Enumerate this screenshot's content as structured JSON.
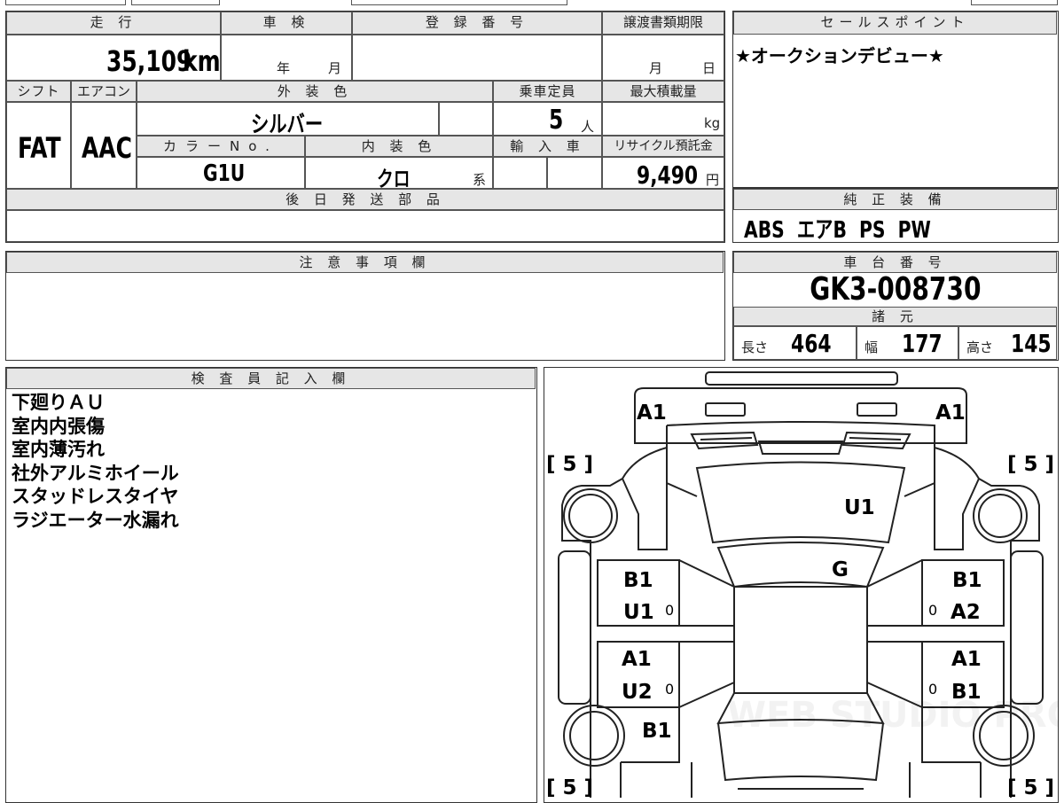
{
  "vehicle": {
    "mileage_label": "走 行",
    "mileage_value": "35,109",
    "mileage_unit": "km",
    "inspection_label": "車 検",
    "inspection_year_unit": "年",
    "inspection_month_unit": "月",
    "registration_label": "登 録 番 号",
    "transfer_deadline_label": "譲渡書類期限",
    "transfer_month_unit": "月",
    "transfer_day_unit": "日",
    "shift_label": "シフト",
    "shift_value": "FAT",
    "aircon_label": "エアコン",
    "aircon_value": "AAC",
    "exterior_color_label": "外 装 色",
    "exterior_color_value": "シルバー",
    "capacity_label": "乗車定員",
    "capacity_value": "5",
    "capacity_unit": "人",
    "max_load_label": "最大積載量",
    "max_load_unit": "kg",
    "color_no_label": "カラーNo.",
    "color_no_value": "G1U",
    "interior_color_label": "内 装 色",
    "interior_color_value": "クロ",
    "interior_color_suffix": "系",
    "import_label": "輸 入 車",
    "recycle_label": "リサイクル預託金",
    "recycle_value": "9,490",
    "recycle_unit": "円",
    "later_parts_label": "後 日 発 送 部 品"
  },
  "sales_point": {
    "label": "セールスポイント",
    "text": "★オークションデビュー★"
  },
  "equipment": {
    "label": "純 正 装 備",
    "items": "ABS  エアB  PS  PW"
  },
  "notes": {
    "label": "注 意 事 項 欄"
  },
  "chassis": {
    "label": "車 台 番 号",
    "number": "GK3-008730",
    "specs_label": "諸 元",
    "length_label": "長さ",
    "length_value": "464",
    "width_label": "幅",
    "width_value": "177",
    "height_label": "高さ",
    "height_value": "145"
  },
  "inspector": {
    "label": "検 査 員 記 入 欄",
    "lines": [
      "下廻りＡＵ",
      "室内内張傷",
      "室内薄汚れ",
      "社外アルミホイール",
      "スタッドレスタイヤ",
      "ラジエーター水漏れ"
    ]
  },
  "diagram": {
    "tread_fl": "[ 5 ]",
    "tread_fr": "[ 5 ]",
    "tread_rl": "[ 5 ]",
    "tread_rr": "[ 5 ]",
    "front_left": "A1",
    "front_right": "A1",
    "hood": "U1",
    "windshield": "G",
    "left_front_door_1": "B1",
    "left_front_door_2": "U1",
    "left_rear_door_1": "A1",
    "left_rear_door_2": "U2",
    "left_rear": "B1",
    "right_front_door_1": "B1",
    "right_front_door_2": "A2",
    "right_rear_door_1": "A1",
    "right_rear_door_2": "B1",
    "zero_mark": "0"
  },
  "watermark": "WEB STUDIO PRO"
}
